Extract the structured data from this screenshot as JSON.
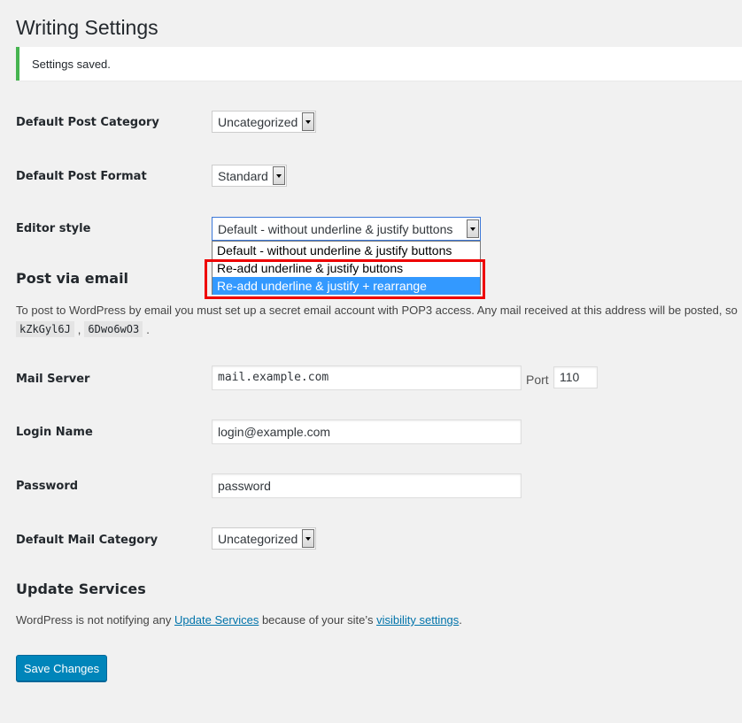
{
  "page": {
    "title": "Writing Settings"
  },
  "notice": {
    "text": "Settings saved."
  },
  "fields": {
    "default_post_category": {
      "label": "Default Post Category",
      "value": "Uncategorized"
    },
    "default_post_format": {
      "label": "Default Post Format",
      "value": "Standard"
    },
    "editor_style": {
      "label": "Editor style",
      "value": "Default - without underline & justify buttons",
      "options": [
        "Default - without underline & justify buttons",
        "Re-add underline & justify buttons",
        "Re-add underline & justify + rearrange"
      ]
    }
  },
  "post_via_email": {
    "title": "Post via email",
    "description": "To post to WordPress by email you must set up a secret email account with POP3 access. Any mail received at this address will be posted, so",
    "code1": "kZkGyl6J",
    "sep": ",",
    "code2": "6Dwo6wO3",
    "end": ".",
    "mail_server": {
      "label": "Mail Server",
      "value": "mail.example.com"
    },
    "port": {
      "label": "Port",
      "value": "110"
    },
    "login_name": {
      "label": "Login Name",
      "value": "login@example.com"
    },
    "password": {
      "label": "Password",
      "value": "password"
    },
    "default_mail_category": {
      "label": "Default Mail Category",
      "value": "Uncategorized"
    }
  },
  "update_services": {
    "title": "Update Services",
    "text_before": "WordPress is not notifying any ",
    "link1": "Update Services",
    "text_middle": " because of your site’s ",
    "link2": "visibility settings",
    "text_after": "."
  },
  "save_button": {
    "label": "Save Changes"
  },
  "colors": {
    "primary": "#0085ba",
    "notice_border": "#46b450",
    "highlight": "#e00000",
    "selected_option": "#3399ff"
  }
}
